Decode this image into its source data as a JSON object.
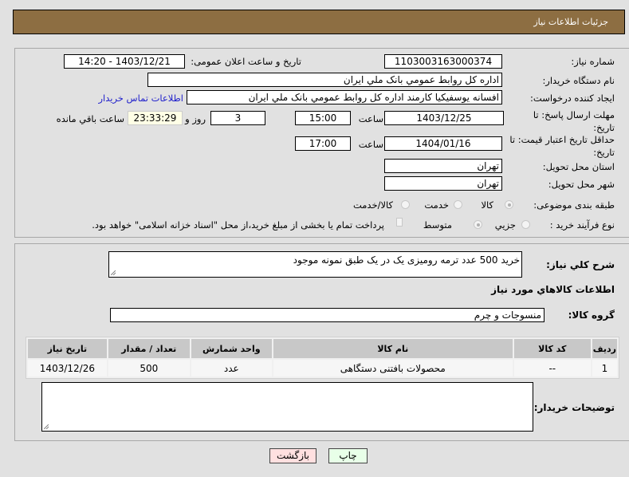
{
  "header": {
    "title": "جزئیات اطلاعات نیاز"
  },
  "form": {
    "need_number_label": "شماره نیاز:",
    "need_number": "1103003163000374",
    "announce_label": "تاریخ و ساعت اعلان عمومی:",
    "announce_value": "1403/12/21 - 14:20",
    "buyer_org_label": "نام دستگاه خریدار:",
    "buyer_org": "اداره كل روابط عمومي بانک ملي ايران",
    "creator_label": "ایجاد کننده درخواست:",
    "creator": "افسانه یوسفیکیا کارمند اداره كل روابط عمومي بانک ملي ايران",
    "contact_link": "اطلاعات تماس خریدار",
    "deadline_label": "مهلت ارسال پاسخ: تا تاریخ:",
    "deadline_date": "1403/12/25",
    "time_label": "ساعت",
    "deadline_time": "15:00",
    "days": "3",
    "days_label": "روز و",
    "remaining": "23:33:29",
    "remaining_label": "ساعت باقي مانده",
    "validity_label": "حداقل تاریخ اعتبار قیمت: تا تاریخ:",
    "validity_date": "1404/01/16",
    "validity_time": "17:00",
    "province_label": "استان محل تحویل:",
    "province": "تهران",
    "city_label": "شهر محل تحویل:",
    "city": "تهران",
    "category_label": "طبقه بندی موضوعی:",
    "category_options": [
      "کالا",
      "خدمت",
      "کالا/خدمت"
    ],
    "category_selected": "کالا",
    "process_label": "نوع فرآیند خرید :",
    "process_options": [
      "جزیي",
      "متوسط"
    ],
    "process_selected": "متوسط",
    "payment_note": "پرداخت تمام یا بخشی از مبلغ خرید،از محل \"اسناد خزانه اسلامی\" خواهد بود."
  },
  "details": {
    "description_label": "شرح كلي نياز:",
    "description": "خرید 500 عدد ترمه رومیزی یک در یک طبق نمونه موجود",
    "goods_info_title": "اطلاعات کالاهاي مورد نياز",
    "group_label": "گروه کالا:",
    "group": "منسوجات و چرم",
    "table": {
      "headers": [
        "ردیف",
        "کد کالا",
        "نام کالا",
        "واحد شمارش",
        "تعداد / مقدار",
        "تاریخ نیاز"
      ],
      "rows": [
        [
          "1",
          "--",
          "محصولات بافتنی دستگاهی",
          "عدد",
          "500",
          "1403/12/26"
        ]
      ]
    },
    "notes_label": "توضیحات خریدار:",
    "notes": ""
  },
  "buttons": {
    "print": "چاپ",
    "back": "بازگشت"
  },
  "colors": {
    "header": "#8d6e42",
    "back_button": "#ffe0e0",
    "print_button": "#e8ffe8",
    "remaining_box": "#ffffe6",
    "link": "#2222cc"
  }
}
